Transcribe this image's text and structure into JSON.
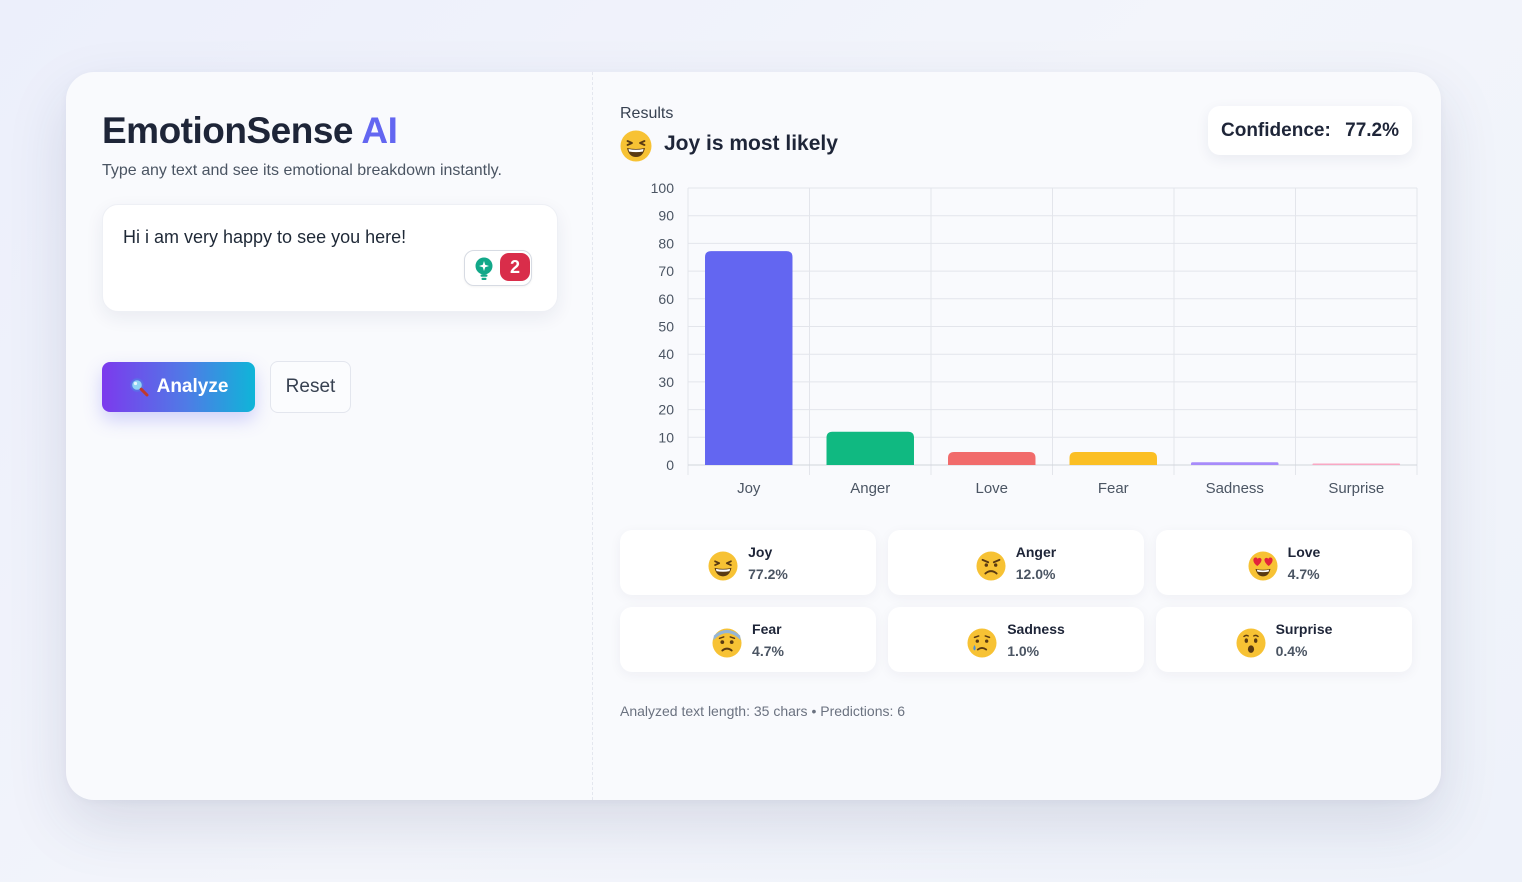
{
  "app": {
    "title_main": "EmotionSense",
    "title_accent": "AI",
    "subtitle": "Type any text and see its emotional breakdown instantly."
  },
  "input": {
    "value": "Hi i am very happy to see you here!",
    "extension_badge_count": "2"
  },
  "buttons": {
    "analyze_label": "Analyze",
    "reset_label": "Reset"
  },
  "results": {
    "section_label": "Results",
    "top_emoji": "grinning-squinting-face",
    "top_label": "Joy is most likely",
    "confidence_label": "Confidence:",
    "confidence_value": "77.2%"
  },
  "colors": {
    "accent": "#6366f1",
    "joy": "#6366f1",
    "anger": "#10b981",
    "love": "#f16b6b",
    "fear": "#fbbf24",
    "sadness": "#a78bfa",
    "surprise": "#f9a8c4"
  },
  "chart_data": {
    "type": "bar",
    "categories": [
      "Joy",
      "Anger",
      "Love",
      "Fear",
      "Sadness",
      "Surprise"
    ],
    "values": [
      77.2,
      12.0,
      4.7,
      4.7,
      1.0,
      0.4
    ],
    "colors": [
      "#6366f1",
      "#10b981",
      "#f16b6b",
      "#fbbf24",
      "#a78bfa",
      "#f9a8c4"
    ],
    "ylim": [
      0,
      100
    ],
    "yticks": [
      0,
      10,
      20,
      30,
      40,
      50,
      60,
      70,
      80,
      90,
      100
    ],
    "grid": true,
    "legend": "none",
    "title": "",
    "xlabel": "",
    "ylabel": ""
  },
  "emotions": [
    {
      "name": "Joy",
      "pct": "77.2%",
      "icon": "grinning-squinting-face"
    },
    {
      "name": "Anger",
      "pct": "12.0%",
      "icon": "angry-face"
    },
    {
      "name": "Love",
      "pct": "4.7%",
      "icon": "heart-eyes-face"
    },
    {
      "name": "Fear",
      "pct": "4.7%",
      "icon": "worried-face"
    },
    {
      "name": "Sadness",
      "pct": "1.0%",
      "icon": "crying-face"
    },
    {
      "name": "Surprise",
      "pct": "0.4%",
      "icon": "surprised-face"
    }
  ],
  "footer": {
    "text": "Analyzed text length: 35 chars • Predictions: 6"
  }
}
